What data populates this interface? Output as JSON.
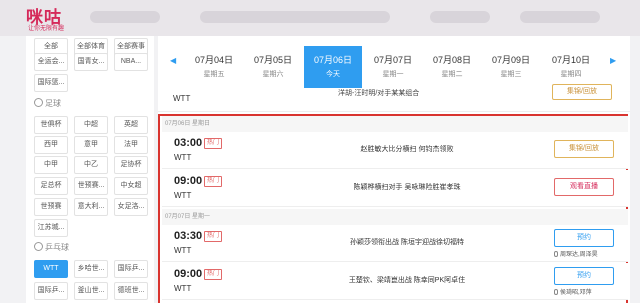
{
  "brand": {
    "logo": "咪咕",
    "tagline": "让你无限有趣"
  },
  "sidebar": {
    "row0": [
      "全部",
      "全部体育",
      "全部赛事"
    ],
    "row1": [
      "全运会...",
      "国青女...",
      "NBA..."
    ],
    "row2": [
      "国际篮..."
    ],
    "football_header": "足球",
    "football": [
      [
        "世俱杯",
        "中超",
        "英超"
      ],
      [
        "西甲",
        "意甲",
        "法甲"
      ],
      [
        "中甲",
        "中乙",
        "足协杯"
      ],
      [
        "足总杯",
        "世预赛...",
        "中女超"
      ],
      [
        "世预赛",
        "意大利...",
        "女足洛..."
      ],
      [
        "江苏城..."
      ]
    ],
    "tabletennis_header": "乒乓球",
    "tabletennis": [
      [
        "WTT",
        "乡哈世...",
        "国际乒..."
      ],
      [
        "国际乒...",
        "釜山世...",
        "德班世..."
      ]
    ]
  },
  "datebar": {
    "prev_arrow": "◀",
    "next_arrow": "▶",
    "dates": [
      {
        "date": "07月04日",
        "weekday": "星期五",
        "active": false
      },
      {
        "date": "07月05日",
        "weekday": "星期六",
        "active": false
      },
      {
        "date": "07月06日",
        "weekday": "今天",
        "active": true
      },
      {
        "date": "07月07日",
        "weekday": "星期一",
        "active": false
      },
      {
        "date": "07月08日",
        "weekday": "星期二",
        "active": false
      },
      {
        "date": "07月09日",
        "weekday": "星期三",
        "active": false
      },
      {
        "date": "07月10日",
        "weekday": "星期四",
        "active": false
      }
    ]
  },
  "top_row": {
    "league": "WTT",
    "title": "洋胡-汪时明/对手某某组合",
    "action": "集锦/回放"
  },
  "days": [
    {
      "label": "07月06日 星期日"
    },
    {
      "label": "07月07日 星期一"
    }
  ],
  "matches": [
    {
      "time": "03:00",
      "tag": "热门",
      "league": "WTT",
      "title": "赵胜敏大比分横扫 何钧杰领败",
      "action": "集锦/回放",
      "action_style": "gold",
      "commentator": ""
    },
    {
      "time": "09:00",
      "tag": "热门",
      "league": "WTT",
      "title": "陈颖桦横扫对手 吴咏琳险胜崔孝珠",
      "action": "观看直播",
      "action_style": "red",
      "commentator": ""
    },
    {
      "time": "03:30",
      "tag": "热门",
      "league": "WTT",
      "title": "孙颖莎领衔出战 陈垣宇迎战徐切福特",
      "action": "预约",
      "action_style": "blue",
      "commentator": "周琛达,周泽昊"
    },
    {
      "time": "09:00",
      "tag": "热门",
      "league": "WTT",
      "title": "王楚钦、梁靖崑出战 陈幸同PK阿卓住",
      "action": "预约",
      "action_style": "blue",
      "commentator": "侯琦昭,邓萍"
    }
  ]
}
